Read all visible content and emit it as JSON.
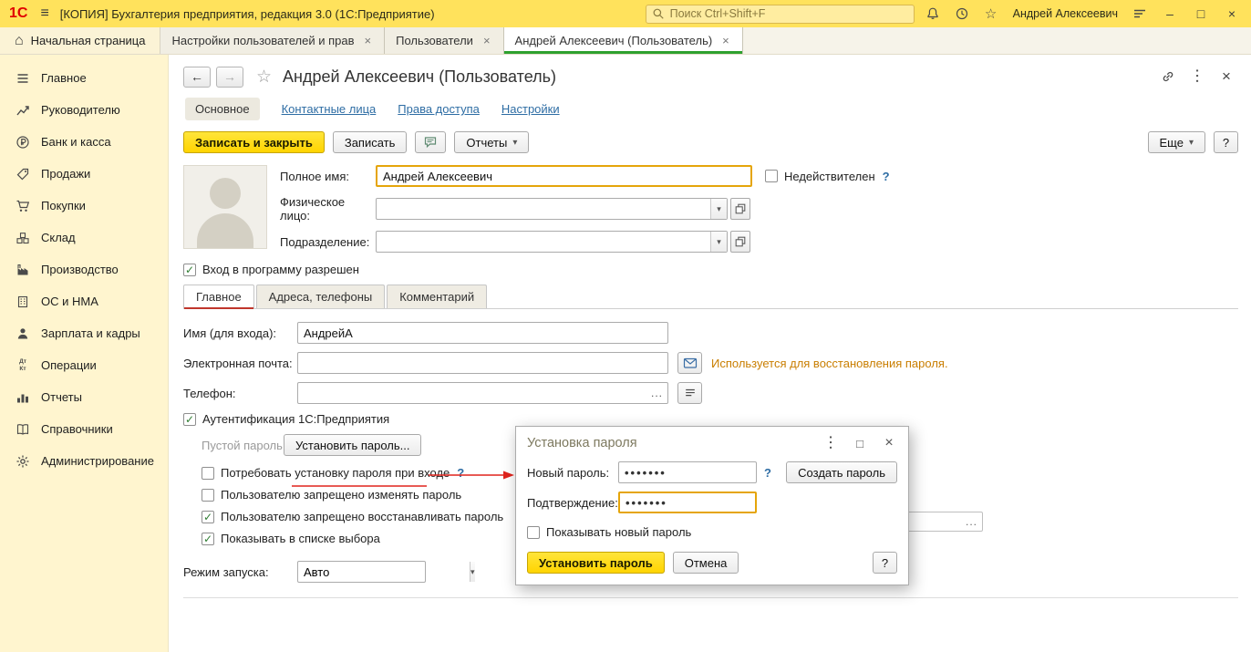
{
  "icons": {
    "menu": "≡",
    "home": "⌂",
    "star": "☆",
    "minimize": "–",
    "maximize": "□",
    "close": "×",
    "caret": "▾",
    "back": "←",
    "forward": "→",
    "check": "✓",
    "ellipsis": "...",
    "dots": "···",
    "help": "?"
  },
  "titlebar": {
    "logo": "1С",
    "app_title": "[КОПИЯ] Бухгалтерия предприятия, редакция 3.0  (1С:Предприятие)",
    "search_placeholder": "Поиск Ctrl+Shift+F",
    "user_name": "Андрей Алексеевич"
  },
  "tabbar": {
    "home_label": "Начальная страница",
    "tabs": [
      {
        "label": "Настройки пользователей и прав"
      },
      {
        "label": "Пользователи"
      },
      {
        "label": "Андрей Алексеевич (Пользователь)",
        "active": true
      }
    ]
  },
  "sidebar": {
    "items": [
      {
        "label": "Главное"
      },
      {
        "label": "Руководителю"
      },
      {
        "label": "Банк и касса"
      },
      {
        "label": "Продажи"
      },
      {
        "label": "Покупки"
      },
      {
        "label": "Склад"
      },
      {
        "label": "Производство"
      },
      {
        "label": "ОС и НМА"
      },
      {
        "label": "Зарплата и кадры"
      },
      {
        "label": "Операции",
        "icon_top": "Дт",
        "icon_bottom": "Кт"
      },
      {
        "label": "Отчеты"
      },
      {
        "label": "Справочники"
      },
      {
        "label": "Администрирование"
      }
    ]
  },
  "main": {
    "title": "Андрей Алексеевич (Пользователь)",
    "sections": {
      "active": "Основное",
      "links": [
        "Контактные лица",
        "Права доступа",
        "Настройки"
      ]
    },
    "toolbar": {
      "save_close": "Записать и закрыть",
      "save": "Записать",
      "reports": "Отчеты",
      "more": "Еще",
      "help": "?"
    },
    "form": {
      "full_name": {
        "label": "Полное имя:",
        "value": "Андрей Алексеевич"
      },
      "invalid": {
        "label": "Недействителен",
        "help": "?"
      },
      "person": {
        "label": "Физическое лицо:",
        "value": ""
      },
      "department": {
        "label": "Подразделение:",
        "value": ""
      },
      "login_allowed": "Вход в программу разрешен",
      "tabs": {
        "active": "Главное",
        "others": [
          "Адреса, телефоны",
          "Комментарий"
        ]
      },
      "login": {
        "label": "Имя (для входа):",
        "value": "АндрейА"
      },
      "email": {
        "label": "Электронная почта:",
        "value": "",
        "hint": "Используется для восстановления пароля."
      },
      "phone": {
        "label": "Телефон:",
        "value": ""
      },
      "auth_1c": "Аутентификация 1С:Предприятия",
      "empty_password": "Пустой пароль",
      "set_password": "Установить пароль...",
      "options": [
        {
          "label": "Потребовать установку пароля при входе",
          "checked": false,
          "help": "?"
        },
        {
          "label": "Пользователю запрещено изменять пароль",
          "checked": false
        },
        {
          "label": "Пользователю запрещено восстанавливать пароль",
          "checked": true
        },
        {
          "label": "Показывать в списке выбора",
          "checked": true
        }
      ],
      "run_mode": {
        "label": "Режим запуска:",
        "value": "Авто"
      }
    }
  },
  "dialog": {
    "title": "Установка пароля",
    "new_password_label": "Новый пароль:",
    "new_password_value": "•••••••",
    "help": "?",
    "create_password_button": "Создать пароль",
    "confirm_label": "Подтверждение:",
    "confirm_value": "•••••••",
    "show_password_label": "Показывать новый пароль",
    "set_password_button": "Установить пароль",
    "cancel_button": "Отмена"
  }
}
